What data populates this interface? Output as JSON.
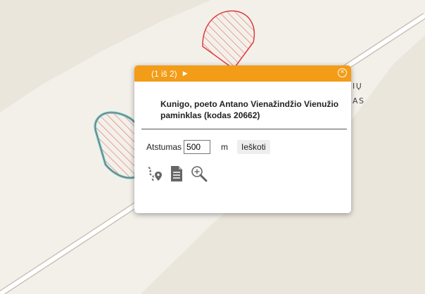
{
  "map": {
    "labels": [
      "IŲ",
      "AS"
    ]
  },
  "popup": {
    "pager": "(1 iš 2)",
    "next_icon": "next-arrow-icon",
    "close_icon": "close-icon",
    "title": "Kunigo, poeto Antano Vienažindžio Vienužio paminklas (kodas 20662)",
    "distance_label": "Atstumas",
    "distance_value": "500",
    "unit": "m",
    "search_label": "Ieškoti",
    "tools": [
      "route-icon",
      "document-icon",
      "zoom-in-icon"
    ]
  },
  "colors": {
    "header": "#f39c18",
    "polygon_outline": "#e03a3a",
    "selected_outline": "#40d8d8",
    "road": "#ffffff",
    "land": "#ebe6dc"
  }
}
